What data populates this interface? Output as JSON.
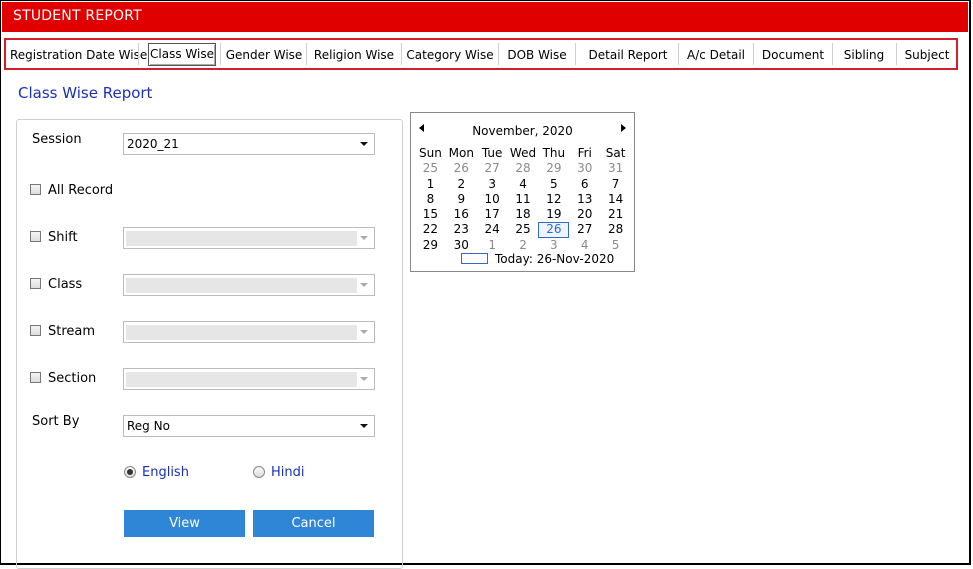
{
  "window": {
    "title": "STUDENT REPORT"
  },
  "tabs": [
    {
      "label": "Registration Date Wise"
    },
    {
      "label": "Class Wise"
    },
    {
      "label": "Gender Wise"
    },
    {
      "label": "Religion Wise"
    },
    {
      "label": "Category Wise"
    },
    {
      "label": "DOB Wise"
    },
    {
      "label": "Detail Report"
    },
    {
      "label": "A/c Detail"
    },
    {
      "label": "Document"
    },
    {
      "label": "Sibling"
    },
    {
      "label": "Subject"
    }
  ],
  "active_tab": "Class Wise",
  "page_title": "Class Wise Report",
  "form": {
    "session": {
      "label": "Session",
      "value": "2020_21"
    },
    "all_record": {
      "label": "All Record",
      "checked": false
    },
    "shift": {
      "label": "Shift",
      "checked": false,
      "value": ""
    },
    "class": {
      "label": "Class",
      "checked": false,
      "value": ""
    },
    "stream": {
      "label": "Stream",
      "checked": false,
      "value": ""
    },
    "section": {
      "label": "Section",
      "checked": false,
      "value": ""
    },
    "sort_by": {
      "label": "Sort By",
      "value": "Reg No"
    },
    "language": {
      "english": "English",
      "hindi": "Hindi",
      "selected": "English"
    },
    "view_label": "View",
    "cancel_label": "Cancel"
  },
  "calendar": {
    "month_label": "November, 2020",
    "day_headers": [
      "Sun",
      "Mon",
      "Tue",
      "Wed",
      "Thu",
      "Fri",
      "Sat"
    ],
    "weeks": [
      [
        "25",
        "26",
        "27",
        "28",
        "29",
        "30",
        "31"
      ],
      [
        "1",
        "2",
        "3",
        "4",
        "5",
        "6",
        "7"
      ],
      [
        "8",
        "9",
        "10",
        "11",
        "12",
        "13",
        "14"
      ],
      [
        "15",
        "16",
        "17",
        "18",
        "19",
        "20",
        "21"
      ],
      [
        "22",
        "23",
        "24",
        "25",
        "26",
        "27",
        "28"
      ],
      [
        "29",
        "30",
        "1",
        "2",
        "3",
        "4",
        "5"
      ]
    ],
    "today_label": "Today: 26-Nov-2020",
    "selected_day": "26"
  },
  "colors": {
    "title_bar": "#e00000",
    "tab_border": "#d21f2b",
    "accent": "#1c2fb8",
    "button": "#2f86d6"
  }
}
